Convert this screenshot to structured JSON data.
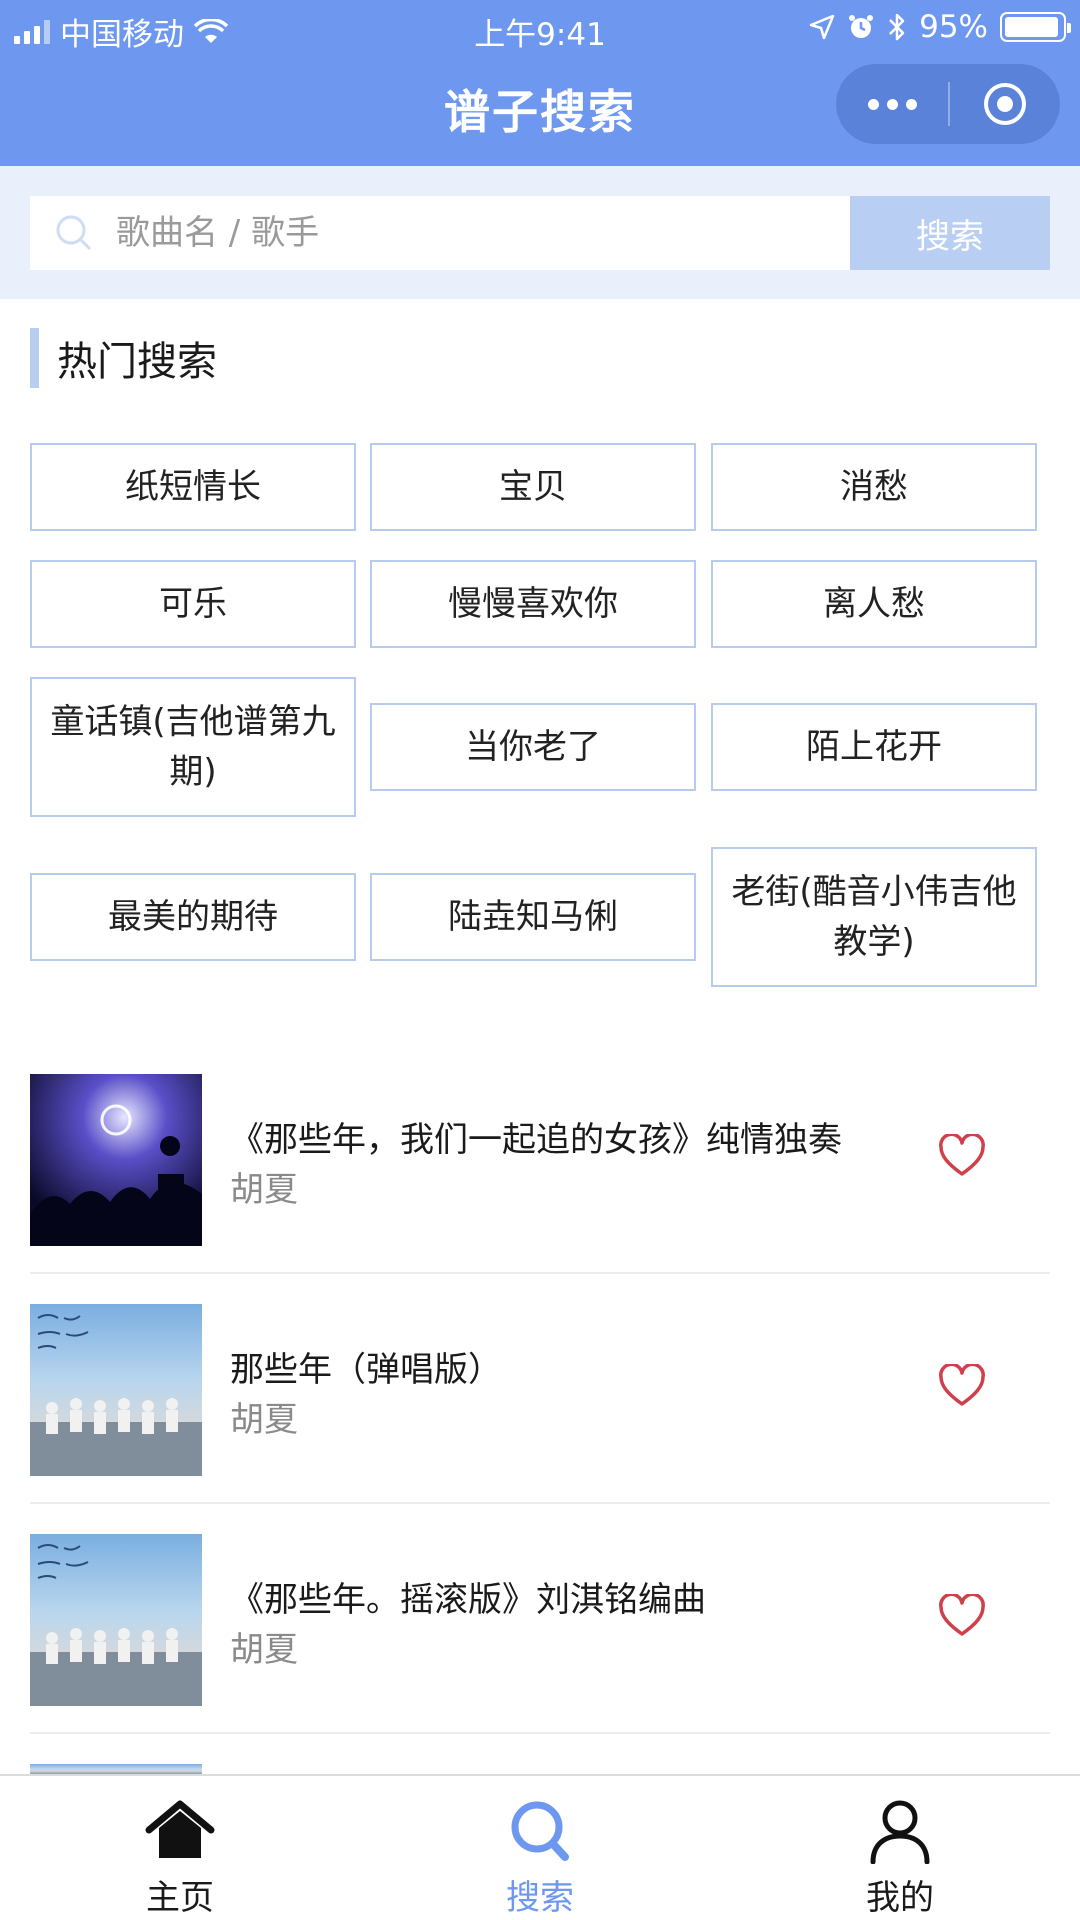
{
  "status_bar": {
    "carrier": "中国移动",
    "time": "上午9:41",
    "battery": "95%",
    "battery_level": 0.95
  },
  "nav": {
    "title": "谱子搜索"
  },
  "search": {
    "placeholder": "歌曲名 / 歌手",
    "button_label": "搜索"
  },
  "hot_search": {
    "title": "热门搜索",
    "tags": [
      "纸短情长",
      "宝贝",
      "消愁",
      "可乐",
      "慢慢喜欢你",
      "离人愁",
      "童话镇(吉他谱第九期)",
      "当你老了",
      "陌上花开",
      "最美的期待",
      "陆垚知马俐",
      "老街(酷音小伟吉他教学)"
    ]
  },
  "results": [
    {
      "title": "《那些年，我们一起追的女孩》纯情独奏",
      "artist": "胡夏"
    },
    {
      "title": "那些年（弹唱版）",
      "artist": "胡夏"
    },
    {
      "title": "《那些年。摇滚版》刘淇铭编曲",
      "artist": "胡夏"
    }
  ],
  "tabbar": {
    "items": [
      {
        "label": "主页",
        "icon": "home-icon"
      },
      {
        "label": "搜索",
        "icon": "search-icon"
      },
      {
        "label": "我的",
        "icon": "user-icon"
      }
    ],
    "active_index": 1
  },
  "colors": {
    "header": "#6e98ef",
    "accent": "#6e98ef",
    "tag_border": "#b6cbee",
    "heart": "#d0404a"
  }
}
